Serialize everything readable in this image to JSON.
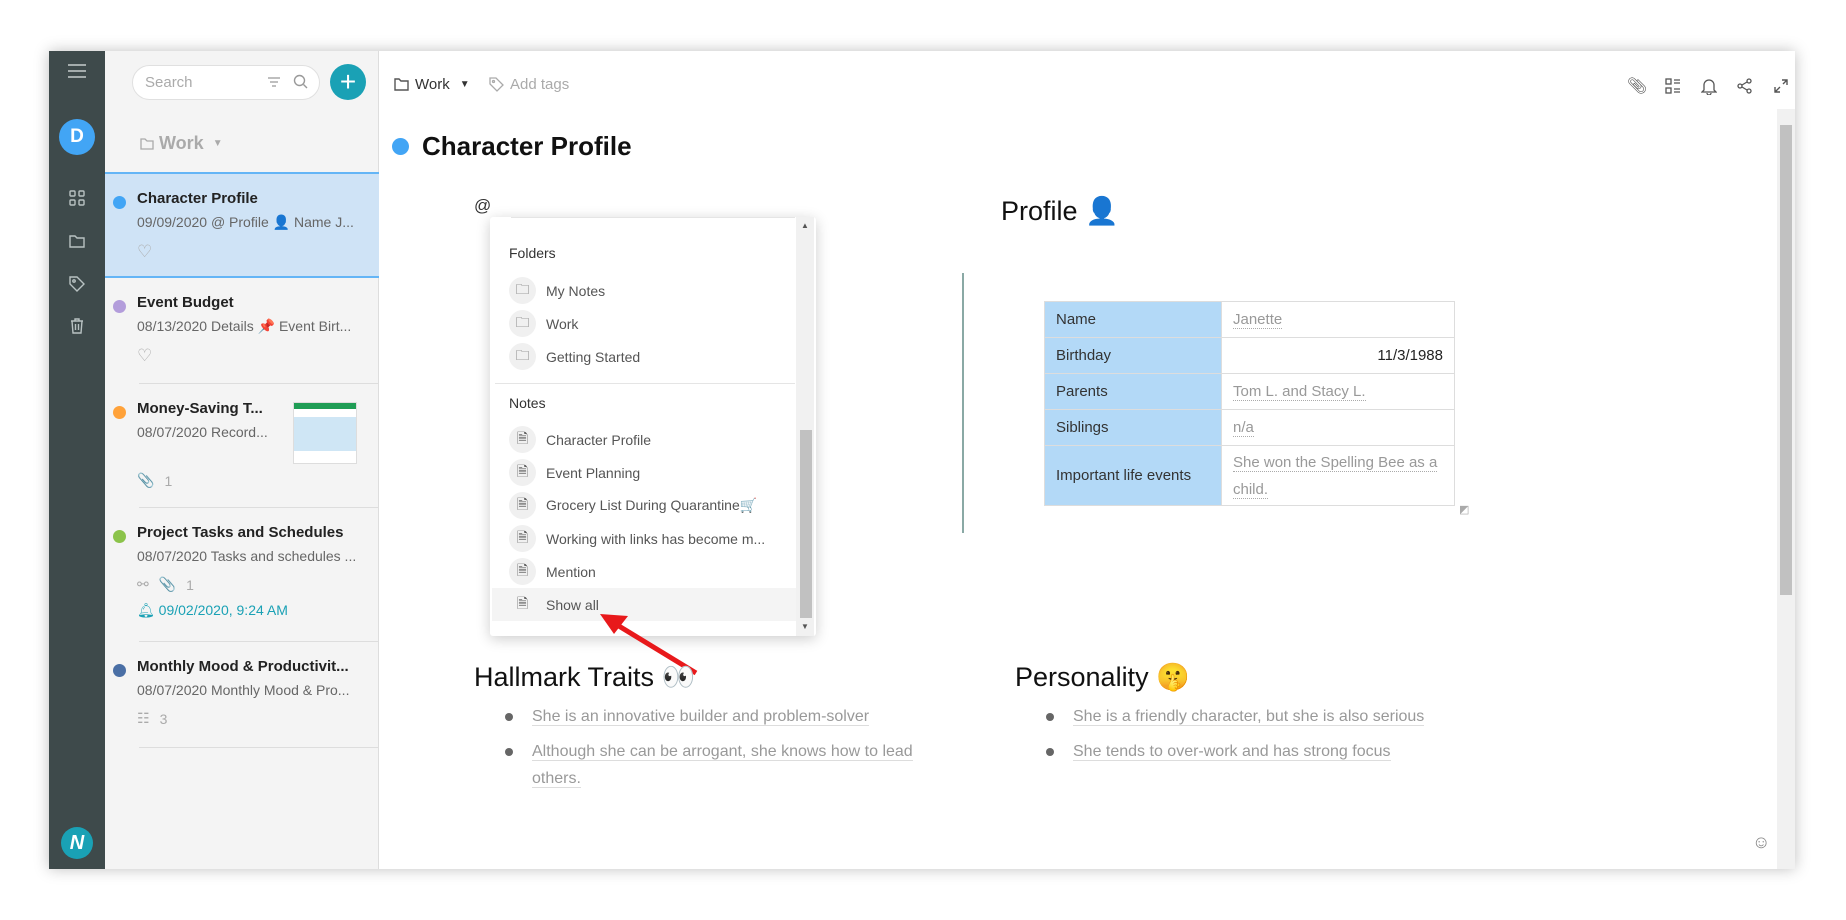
{
  "rail": {
    "avatar_letter": "D",
    "icons": [
      "menu-icon",
      "grid-icon",
      "folder-icon",
      "tag-icon",
      "trash-icon"
    ],
    "logo": "N"
  },
  "list": {
    "search_placeholder": "Search",
    "folder": "Work",
    "notes": [
      {
        "title": "Character Profile",
        "preview": "09/09/2020 @ Profile 👤 Name J...",
        "color": "#42a5f5",
        "meta": "♡"
      },
      {
        "title": "Event Budget",
        "preview": "08/13/2020 Details 📌 Event Birt...",
        "color": "#b39ddb",
        "meta": "♡"
      },
      {
        "title": "Money-Saving T...",
        "preview": "08/07/2020 Record...",
        "color": "#ffa23a",
        "meta": "1"
      },
      {
        "title": "Project Tasks and Schedules",
        "preview": "08/07/2020 Tasks and schedules ...",
        "color": "#8bc34a",
        "meta": "1",
        "reminder": "09/02/2020, 9:24 AM"
      },
      {
        "title": "Monthly Mood & Productivit...",
        "preview": "08/07/2020 Monthly Mood & Pro...",
        "color": "#4a6fa5",
        "meta": "3"
      }
    ]
  },
  "toolbar": {
    "folder": "Work",
    "add_tags": "Add tags"
  },
  "note": {
    "title": "Character Profile",
    "color": "#42a5f5",
    "mention_char": "@",
    "dropdown": {
      "folders_label": "Folders",
      "folders": [
        "My Notes",
        "Work",
        "Getting Started"
      ],
      "notes_label": "Notes",
      "notes": [
        "Character Profile",
        "Event Planning",
        "Grocery List During Quarantine🛒",
        "Working with links has become m...",
        "Mention"
      ],
      "show_all": "Show all"
    },
    "profile_heading": "Profile 👤",
    "table": [
      [
        "Name",
        "Janette"
      ],
      [
        "Birthday",
        "11/3/1988"
      ],
      [
        "Parents",
        "Tom L. and Stacy L."
      ],
      [
        "Siblings",
        "n/a"
      ],
      [
        "Important life events",
        "She won the Spelling Bee as a child."
      ]
    ],
    "traits_heading": "Hallmark Traits 👀",
    "traits": [
      "She is an innovative builder and problem-solver",
      "Although she can be arrogant, she knows how to lead others."
    ],
    "personality_heading": "Personality 🤫",
    "personality": [
      "She is a friendly character, but she is also serious",
      "She tends to over-work and has strong focus"
    ]
  },
  "colors": {
    "rail": "#3e4a4b",
    "accent": "#1aa1b5",
    "selected": "#cfe3f6",
    "table_key": "#b3d9f7",
    "annotation_arrow": "#e8191b"
  }
}
